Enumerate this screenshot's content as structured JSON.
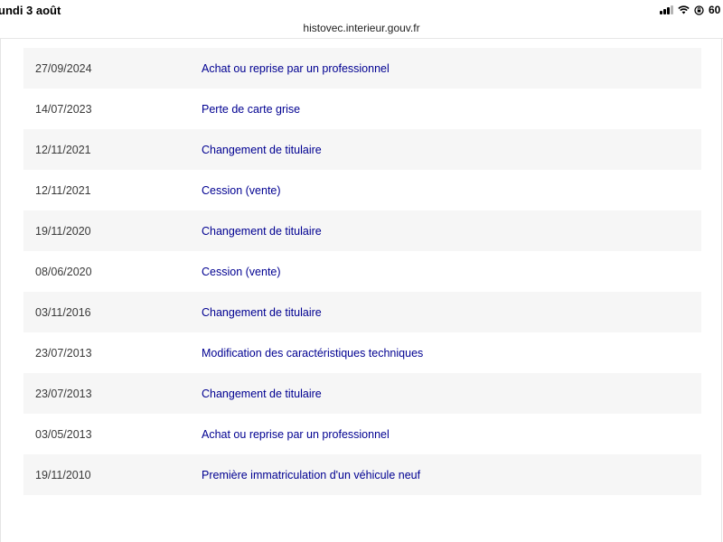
{
  "status_bar": {
    "date": "undi 3 août",
    "battery": "60"
  },
  "browser": {
    "url": "histovec.interieur.gouv.fr"
  },
  "history": {
    "rows": [
      {
        "date": "27/09/2024",
        "event": "Achat ou reprise par un professionnel"
      },
      {
        "date": "14/07/2023",
        "event": "Perte de carte grise"
      },
      {
        "date": "12/11/2021",
        "event": "Changement de titulaire"
      },
      {
        "date": "12/11/2021",
        "event": "Cession (vente)"
      },
      {
        "date": "19/11/2020",
        "event": "Changement de titulaire"
      },
      {
        "date": "08/06/2020",
        "event": "Cession (vente)"
      },
      {
        "date": "03/11/2016",
        "event": "Changement de titulaire"
      },
      {
        "date": "23/07/2013",
        "event": "Modification des caractéristiques techniques"
      },
      {
        "date": "23/07/2013",
        "event": "Changement de titulaire"
      },
      {
        "date": "03/05/2013",
        "event": "Achat ou reprise par un professionnel"
      },
      {
        "date": "19/11/2010",
        "event": "Première immatriculation d'un véhicule neuf"
      }
    ]
  },
  "colors": {
    "event_text": "#000091",
    "row_stripe": "#f6f6f6"
  }
}
